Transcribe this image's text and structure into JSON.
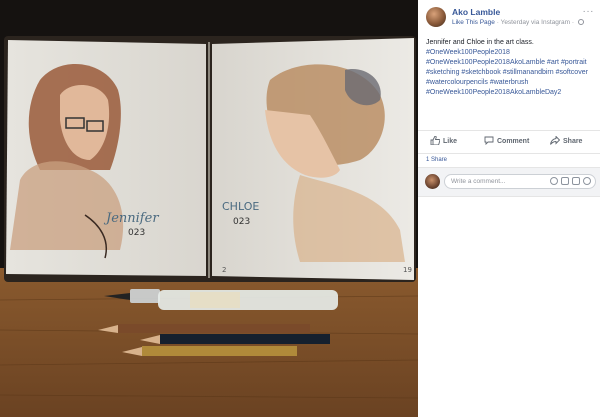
{
  "post": {
    "author": "Ako Lamble",
    "like_page": "Like This Page",
    "separator": "·",
    "timestamp": "Yesterday via Instagram",
    "separator2": "·",
    "more": "···",
    "caption_line": "Jennifer and Chloe in the art class.",
    "hashtags": [
      "#OneWeek100People2018",
      "#OneWeek100People2018AkoLamble",
      "#art",
      "#portrait",
      "#sketching",
      "#sketchbook",
      "#stillmanandbirn",
      "#softcover",
      "#watercolourpencils",
      "#waterbrush",
      "#OneWeek100People2018AkoLambleDay2"
    ]
  },
  "actions": {
    "like": "Like",
    "comment": "Comment",
    "share": "Share"
  },
  "shares_count": "1 Share",
  "comment_box": {
    "placeholder": "Write a comment..."
  },
  "photo": {
    "label_left": "Jennifer",
    "number_left": "023",
    "label_right": "CHLOE",
    "number_right": "023",
    "page_left": "2",
    "page_right": "19"
  },
  "colors": {
    "link": "#385898",
    "meta": "#90949c",
    "text": "#1d2129"
  }
}
